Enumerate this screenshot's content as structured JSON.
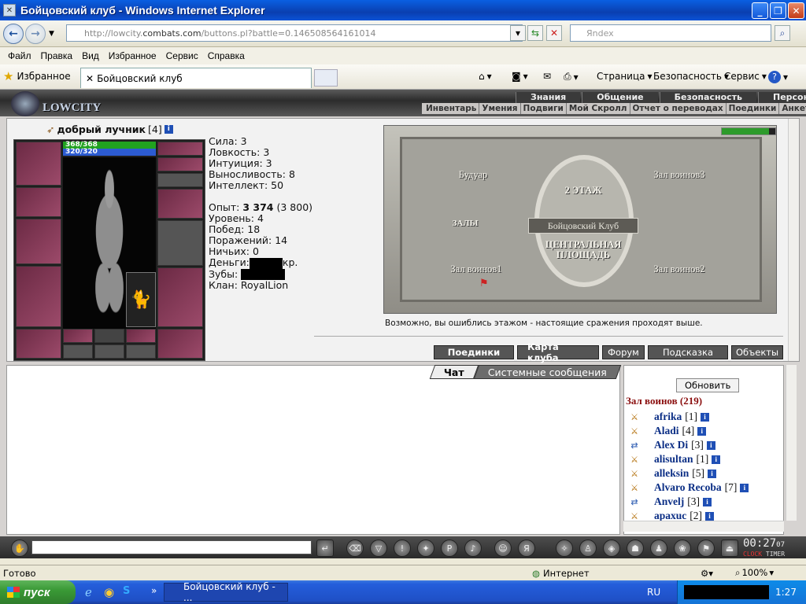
{
  "window": {
    "title": "Бойцовский клуб - Windows Internet Explorer"
  },
  "address": {
    "url_prefix": "http://lowcity.",
    "url_domain": "combats.com",
    "url_path": "/buttons.pl?battle=0.146508564161014",
    "search_placeholder": "Яndex"
  },
  "menu": [
    "Файл",
    "Правка",
    "Вид",
    "Избранное",
    "Сервис",
    "Справка"
  ],
  "favbar": {
    "favorites_label": "Избранное",
    "tab_title": "Бойцовский клуб",
    "page_label": "Страница",
    "security_label": "Безопасность",
    "service_label": "Сервис"
  },
  "game": {
    "logo": "LOWCITY",
    "top_tabs": [
      "Знания",
      "Общение",
      "Безопасность",
      "Персонаж"
    ],
    "sub_tabs": [
      "Инвентарь",
      "Умения",
      "Подвиги",
      "Мой Скролл",
      "Отчет о переводах",
      "Поединки",
      "Анкета"
    ],
    "character": {
      "name": "добрый лучник",
      "level": "[4]",
      "hp": "368/368",
      "mana": "320/320",
      "stats": {
        "strength": "Сила: 3",
        "agility": "Ловкость: 3",
        "intuition": "Интуиция: 3",
        "endurance": "Выносливость: 8",
        "intellect": "Интеллект: 50",
        "exp_label": "Опыт: ",
        "exp_value": "3 374",
        "exp_next": " (3 800)",
        "level": "Уровень: 4",
        "wins": "Побед: 18",
        "losses": "Поражений: 14",
        "draws": "Ничьих: 0",
        "money_label": "Деньги:",
        "money_suffix": "кр.",
        "teeth_label": "Зубы:",
        "clan": "Клан: RoyalLion"
      }
    },
    "map": {
      "rooms": {
        "boudoir": "Будуар",
        "warriors3": "Зал воинов3",
        "halls": "ЗАЛЫ",
        "warriors1": "Зал воинов1",
        "warriors2": "Зал воинов2"
      },
      "floor": "2 ЭТАЖ",
      "club": "Бойцовский Клуб",
      "square": "ЦЕНТРАЛЬНАЯ ПЛОЩАДЬ",
      "note": "Возможно, вы ошиблись этажом - настоящие сражения проходят выше."
    },
    "buttons": [
      "Поединки",
      "Карта клуба",
      "Форум",
      "Подсказка",
      "Объекты"
    ],
    "chat_tabs": [
      "Чат",
      "Системные сообщения"
    ],
    "online": {
      "refresh": "Обновить",
      "room_title": "Зал воинов (219)",
      "users": [
        {
          "name": "afrika",
          "level": "[1]"
        },
        {
          "name": "Aladi",
          "level": "[4]"
        },
        {
          "name": "Alex Di",
          "level": "[3]"
        },
        {
          "name": "alisultan",
          "level": "[1]"
        },
        {
          "name": "alleksin",
          "level": "[5]"
        },
        {
          "name": "Alvaro Recoba",
          "level": "[7]"
        },
        {
          "name": "Anvelj",
          "level": "[3]"
        },
        {
          "name": "apaxuc",
          "level": "[2]"
        }
      ]
    },
    "clock": {
      "time": "00:27",
      "seconds": "07",
      "clock_label": "CLOCK",
      "timer_label": "TIMER"
    }
  },
  "status": {
    "ready": "Готово",
    "zone": "Интернет",
    "zoom": "100%"
  },
  "taskbar": {
    "start": "пуск",
    "task": "Бойцовский клуб - ...",
    "lang": "RU",
    "time": "1:27"
  }
}
